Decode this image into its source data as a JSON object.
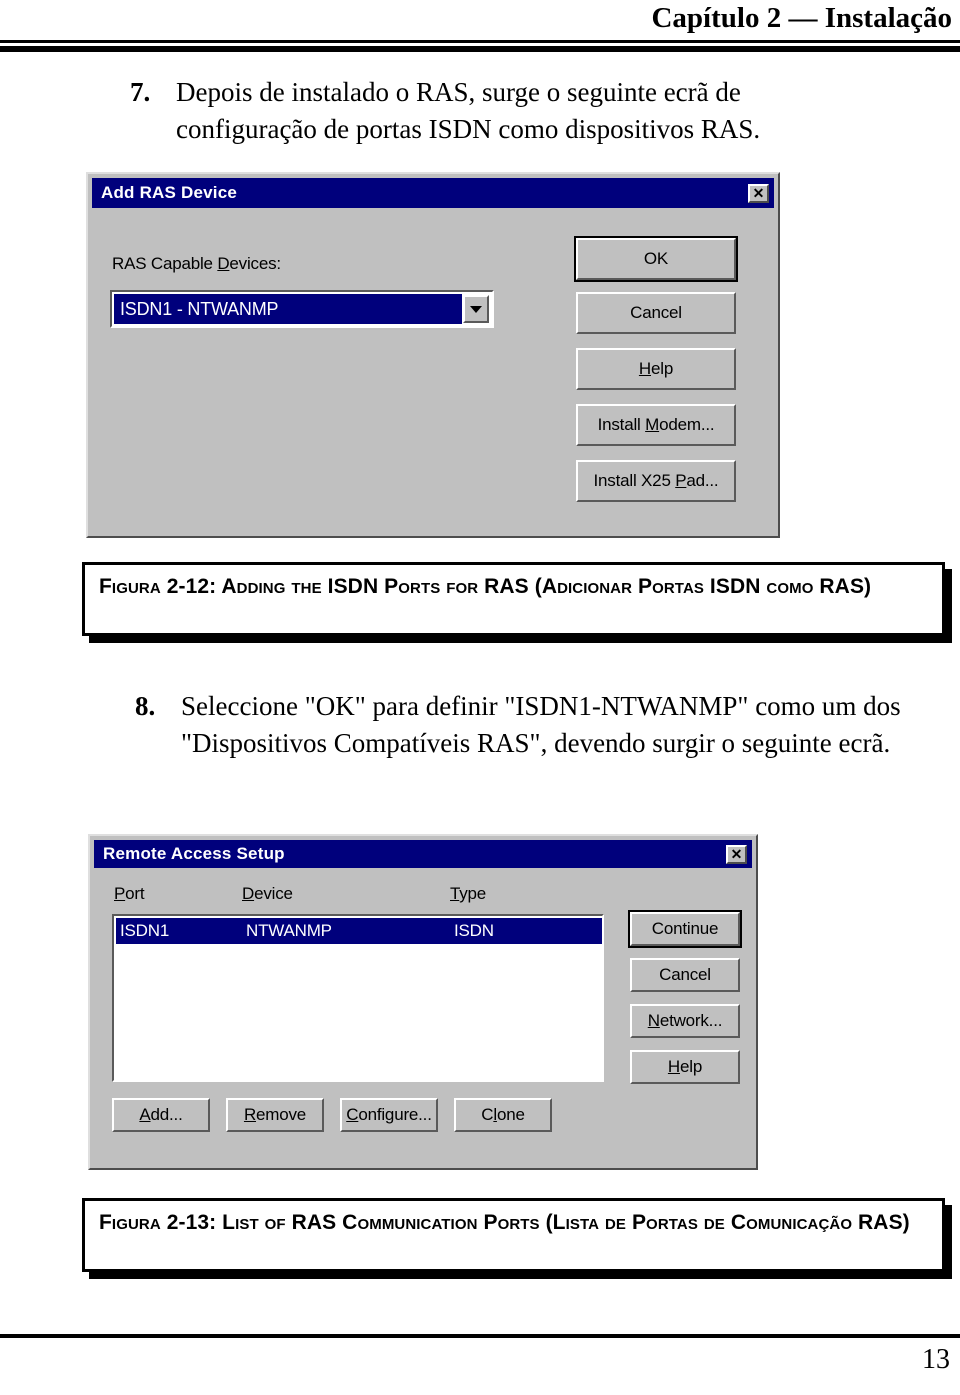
{
  "header": {
    "title": "Capítulo 2 — Instalação"
  },
  "footer": {
    "page_number": "13"
  },
  "steps": [
    {
      "number": "7.",
      "text": "Depois de instalado o RAS, surge o seguinte ecrã de configuração de portas ISDN como dispositivos RAS."
    },
    {
      "number": "8.",
      "text": "Seleccione \"OK\" para definir \"ISDN1-NTWANMP\" como um dos \"Dispositivos Compatíveis RAS\", devendo surgir o seguinte ecrã."
    }
  ],
  "dialog_add_ras_device": {
    "title": "Add RAS Device",
    "close_label": "✕",
    "devices_label": "RAS Capable Devices:",
    "combo_value": "ISDN1 - NTWANMP",
    "buttons": [
      {
        "label": "OK",
        "default": true
      },
      {
        "label": "Cancel",
        "default": false
      },
      {
        "label": "Help",
        "default": false
      },
      {
        "label": "Install Modem...",
        "default": false
      },
      {
        "label": "Install X25 Pad...",
        "default": false
      }
    ]
  },
  "figure_2_12": {
    "caption": "Figura 2-12: Adding the ISDN Ports for RAS (Adicionar Portas ISDN como RAS)"
  },
  "dialog_remote_access_setup": {
    "title": "Remote Access Setup",
    "close_label": "✕",
    "columns": [
      "Port",
      "Device",
      "Type"
    ],
    "rows": [
      {
        "port": "ISDN1",
        "device": "NTWANMP",
        "type": "ISDN",
        "selected": true
      }
    ],
    "side_buttons": [
      {
        "label": "Continue",
        "default": true
      },
      {
        "label": "Cancel",
        "default": false
      },
      {
        "label": "Network...",
        "default": false
      },
      {
        "label": "Help",
        "default": false
      }
    ],
    "bottom_buttons": [
      {
        "label": "Add..."
      },
      {
        "label": "Remove"
      },
      {
        "label": "Configure..."
      },
      {
        "label": "Clone"
      }
    ]
  },
  "figure_2_13": {
    "caption": "Figura 2-13: List of RAS Communication Ports (Lista de Portas de Comunicação RAS)"
  },
  "colors": {
    "titlebar": "#00007c",
    "dialog_face": "#c0c0c0",
    "selection": "#00007c",
    "text": "#000000"
  }
}
